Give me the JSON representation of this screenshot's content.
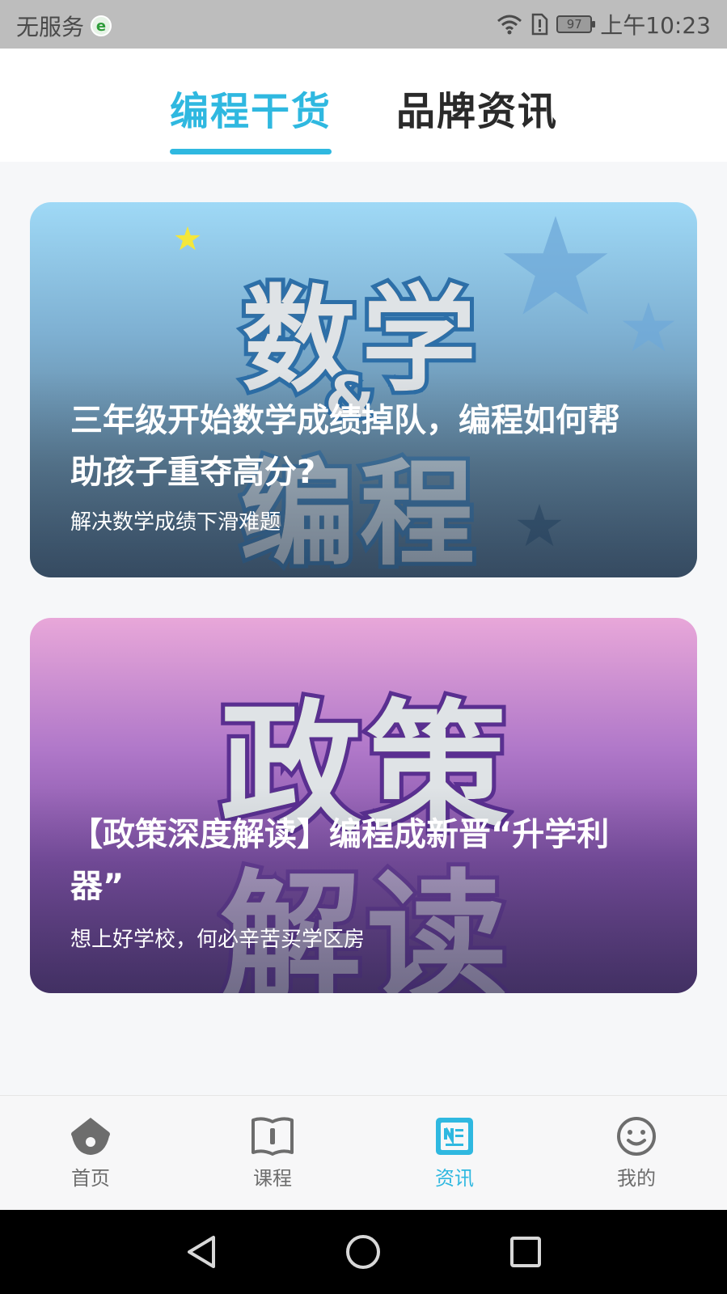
{
  "status_bar": {
    "carrier": "无服务",
    "carrier_badge": "e",
    "battery": "97",
    "time": "上午10:23"
  },
  "tabs": [
    {
      "label": "编程干货",
      "active": true
    },
    {
      "label": "品牌资讯",
      "active": false
    }
  ],
  "articles": [
    {
      "cover_text_1": "数学",
      "cover_text_2": "&",
      "cover_text_3": "编程",
      "title": "三年级开始数学成绩掉队，编程如何帮助孩子重夺高分?",
      "subtitle": "解决数学成绩下滑难题"
    },
    {
      "cover_text_1": "政策",
      "cover_text_2": "解读",
      "title": "【政策深度解读】编程成新晋“升学利器”",
      "subtitle": "想上好学校，何必辛苦买学区房"
    }
  ],
  "bottom_nav": [
    {
      "label": "首页",
      "icon": "home-icon",
      "active": false
    },
    {
      "label": "课程",
      "icon": "book-icon",
      "active": false
    },
    {
      "label": "资讯",
      "icon": "news-icon",
      "active": true
    },
    {
      "label": "我的",
      "icon": "smiley-icon",
      "active": false
    }
  ],
  "colors": {
    "accent": "#2fb8e0",
    "inactive_icon": "#6d6d6d"
  }
}
